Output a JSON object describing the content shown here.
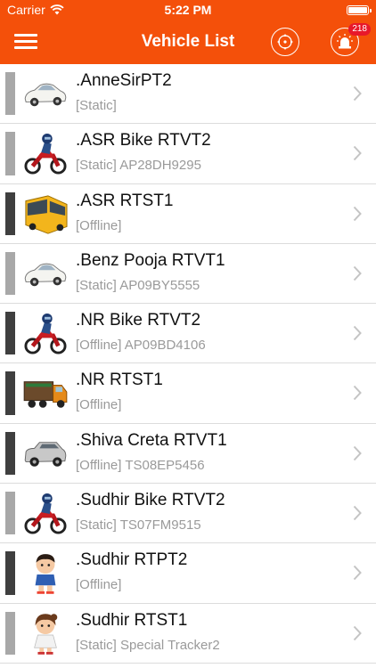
{
  "status_bar": {
    "carrier": "Carrier",
    "time": "5:22 PM"
  },
  "nav": {
    "title": "Vehicle List",
    "alert_badge": "218"
  },
  "colors": {
    "accent": "#f4500a",
    "static_strip": "#a8a8a8",
    "offline_strip": "#3f3f3f",
    "badge": "#e8182a"
  },
  "vehicles": [
    {
      "name": ".AnneSirPT2",
      "detail": "[Static]",
      "status": "static",
      "icon": "car-icon"
    },
    {
      "name": ".ASR Bike RTVT2",
      "detail": "[Static] AP28DH9295",
      "status": "static",
      "icon": "bike-rider-icon"
    },
    {
      "name": ".ASR RTST1",
      "detail": "[Offline]",
      "status": "offline",
      "icon": "bus-icon"
    },
    {
      "name": ".Benz Pooja RTVT1",
      "detail": "[Static] AP09BY5555",
      "status": "static",
      "icon": "car-icon"
    },
    {
      "name": ".NR Bike RTVT2",
      "detail": "[Offline] AP09BD4106",
      "status": "offline",
      "icon": "bike-rider-icon"
    },
    {
      "name": ".NR RTST1",
      "detail": "[Offline]",
      "status": "offline",
      "icon": "truck-icon"
    },
    {
      "name": ".Shiva Creta RTVT1",
      "detail": "[Offline] TS08EP5456",
      "status": "offline",
      "icon": "suv-icon"
    },
    {
      "name": ".Sudhir Bike RTVT2",
      "detail": "[Static] TS07FM9515",
      "status": "static",
      "icon": "bike-rider-icon"
    },
    {
      "name": ".Sudhir RTPT2",
      "detail": "[Offline]",
      "status": "offline",
      "icon": "boy-icon"
    },
    {
      "name": ".Sudhir RTST1",
      "detail": "[Static] Special Tracker2",
      "status": "static",
      "icon": "girl-icon"
    }
  ]
}
